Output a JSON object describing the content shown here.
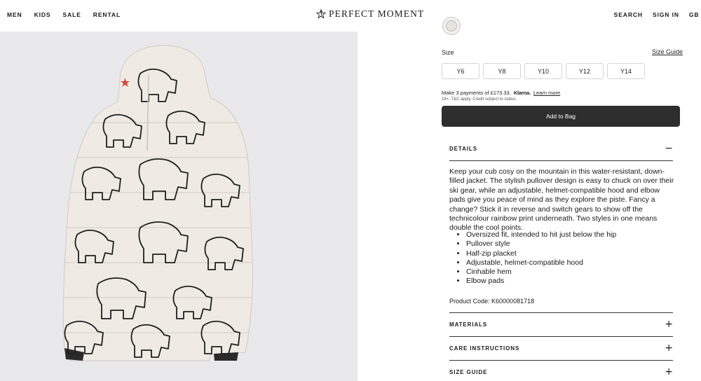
{
  "nav": {
    "left": [
      "MEN",
      "KIDS",
      "SALE",
      "RENTAL"
    ],
    "brand": "PERFECT MOMENT",
    "right": [
      "SEARCH",
      "SIGN IN",
      "GB /"
    ]
  },
  "product": {
    "size_label": "Size",
    "size_guide_link": "Size Guide",
    "sizes": [
      "Y6",
      "Y8",
      "Y10",
      "Y12",
      "Y14"
    ],
    "klarna": {
      "prefix": "Make 3 payments of £173.33.",
      "brand": "Klarna.",
      "learn_more": "Learn more",
      "note": "18+, T&C apply, Credit subject to status."
    },
    "add_to_bag": "Add to Bag"
  },
  "details": {
    "title": "DETAILS",
    "sign": "−",
    "description": "Keep your cub cosy on the mountain in this water-resistant, down-filled jacket. The stylish pullover design is easy to chuck on over their ski gear, while an adjustable, helmet-compatible hood and elbow pads give you peace of mind as they explore the piste. Fancy a change? Stick it in reverse and switch gears to show off the technicolour rainbow print underneath. Two styles in one means double the cool points.",
    "features": [
      "Oversized fit, intended to hit just below the hip",
      "Pullover style",
      "Half-zip placket",
      "Adjustable, helmet-compatible hood",
      "Cinhable hem",
      "Elbow pads"
    ],
    "product_code": "Product Code: K60000081718"
  },
  "accordions": [
    {
      "title": "MATERIALS",
      "sign": "+"
    },
    {
      "title": "CARE INSTRUCTIONS",
      "sign": "+"
    },
    {
      "title": "SIZE GUIDE",
      "sign": "+"
    }
  ],
  "colors": {
    "button_dark": "#2e2e2e",
    "image_bg": "#e9e9eb",
    "jacket": "#efebe4"
  },
  "icons": [
    "star-logo-icon",
    "minus-icon",
    "plus-icon"
  ]
}
